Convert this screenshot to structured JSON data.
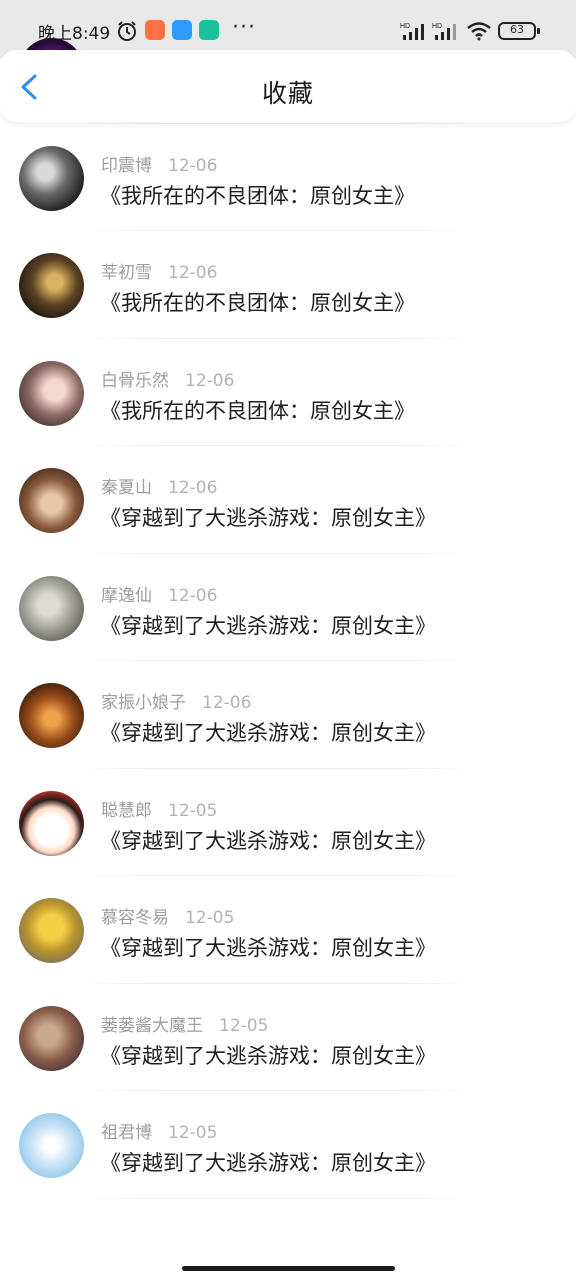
{
  "status_bar": {
    "time": "晚上8:49",
    "battery": "63",
    "signal_label_1": "HD",
    "signal_label_2": "HD"
  },
  "header": {
    "title": "收藏",
    "back_icon": "chevron-left-icon",
    "accent_color": "#2b8ff3"
  },
  "items": [
    {
      "user": "",
      "date": "",
      "book": "《我所在的不良团体：原创女主》"
    },
    {
      "user": "印震博",
      "date": "12-06",
      "book": "《我所在的不良团体：原创女主》"
    },
    {
      "user": "莘初雪",
      "date": "12-06",
      "book": "《我所在的不良团体：原创女主》"
    },
    {
      "user": "白骨乐然",
      "date": "12-06",
      "book": "《我所在的不良团体：原创女主》"
    },
    {
      "user": "秦夏山",
      "date": "12-06",
      "book": "《穿越到了大逃杀游戏：原创女主》"
    },
    {
      "user": "摩逸仙",
      "date": "12-06",
      "book": "《穿越到了大逃杀游戏：原创女主》"
    },
    {
      "user": "家振小娘子",
      "date": "12-06",
      "book": "《穿越到了大逃杀游戏：原创女主》"
    },
    {
      "user": "聪慧郎",
      "date": "12-05",
      "book": "《穿越到了大逃杀游戏：原创女主》"
    },
    {
      "user": "慕容冬易",
      "date": "12-05",
      "book": "《穿越到了大逃杀游戏：原创女主》"
    },
    {
      "user": "蒌蒌酱大魔王",
      "date": "12-05",
      "book": "《穿越到了大逃杀游戏：原创女主》"
    },
    {
      "user": "祖君博",
      "date": "12-05",
      "book": "《穿越到了大逃杀游戏：原创女主》"
    }
  ]
}
